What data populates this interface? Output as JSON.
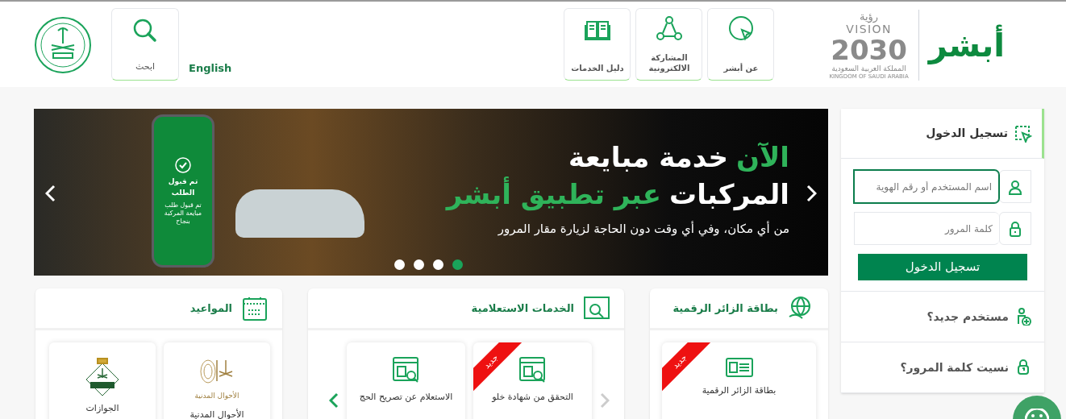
{
  "header": {
    "logo_text": "أبشر",
    "vision": {
      "arabic": "رؤية",
      "latin": "VISION",
      "year": "2030",
      "country_ar": "المملكة العربية السعودية",
      "country_en": "KINGDOM OF SAUDI ARABIA"
    },
    "nav": [
      {
        "kind": "cursor",
        "label": "عن أبشر"
      },
      {
        "kind": "share",
        "label": "المشاركة الالكترونية"
      },
      {
        "kind": "book",
        "label": "دليل الخدمات"
      }
    ],
    "language": "English",
    "search": "ابحث"
  },
  "banner": {
    "headline": [
      [
        {
          "text": "الآن",
          "highlight": true
        },
        {
          "text": "خدمة مبايعة",
          "highlight": false
        }
      ],
      [
        {
          "text": "المركبات",
          "highlight": false
        },
        {
          "text": "عبر تطبيق أبشر",
          "highlight": true
        }
      ]
    ],
    "subtitle": "من أي مكان، وفي أي وقت دون الحاجة لزيارة مقار المرور",
    "phone_title": "تم قبول الطلب",
    "phone_text": "تم قبول طلب مبايعة المركبة بنجاح",
    "dots": [
      {
        "selected": false
      },
      {
        "selected": false
      },
      {
        "selected": false
      },
      {
        "selected": true
      }
    ]
  },
  "login": {
    "title": "تسجيل الدخول",
    "username": {
      "placeholder": "اسم المستخدم أو رقم الهوية",
      "focused": true
    },
    "password": {
      "placeholder": "كلمة المرور",
      "focused": false
    },
    "button": "تسجيل الدخول",
    "links": [
      {
        "kind": "new-user",
        "label": "مستخدم جديد؟"
      },
      {
        "kind": "forgot",
        "label": "نسيت كلمة المرور؟"
      }
    ]
  },
  "cards": [
    {
      "kind": "globe",
      "title": "بطاقة الزائر الرقمية",
      "tiles": [
        {
          "kind": "id-card",
          "label": "بطاقة الزائر الرقمية",
          "badge": "جديد"
        }
      ]
    },
    {
      "kind": "search",
      "title": "الخدمات الاستعلامية",
      "prev_disabled": true,
      "next_disabled": false,
      "tiles": [
        {
          "kind": "doc-search",
          "label": "التحقق من شهادة خلو",
          "badge": "جديد"
        },
        {
          "kind": "doc-search",
          "label": "الاستعلام عن تصريح الحج"
        }
      ]
    },
    {
      "kind": "calendar",
      "title": "المواعيد",
      "tiles": [
        {
          "kind": "civil",
          "label": "الأحوال المدنية",
          "logo_text": "الأحوال المدنية"
        },
        {
          "kind": "passports",
          "label": "الجوازات"
        }
      ]
    }
  ]
}
